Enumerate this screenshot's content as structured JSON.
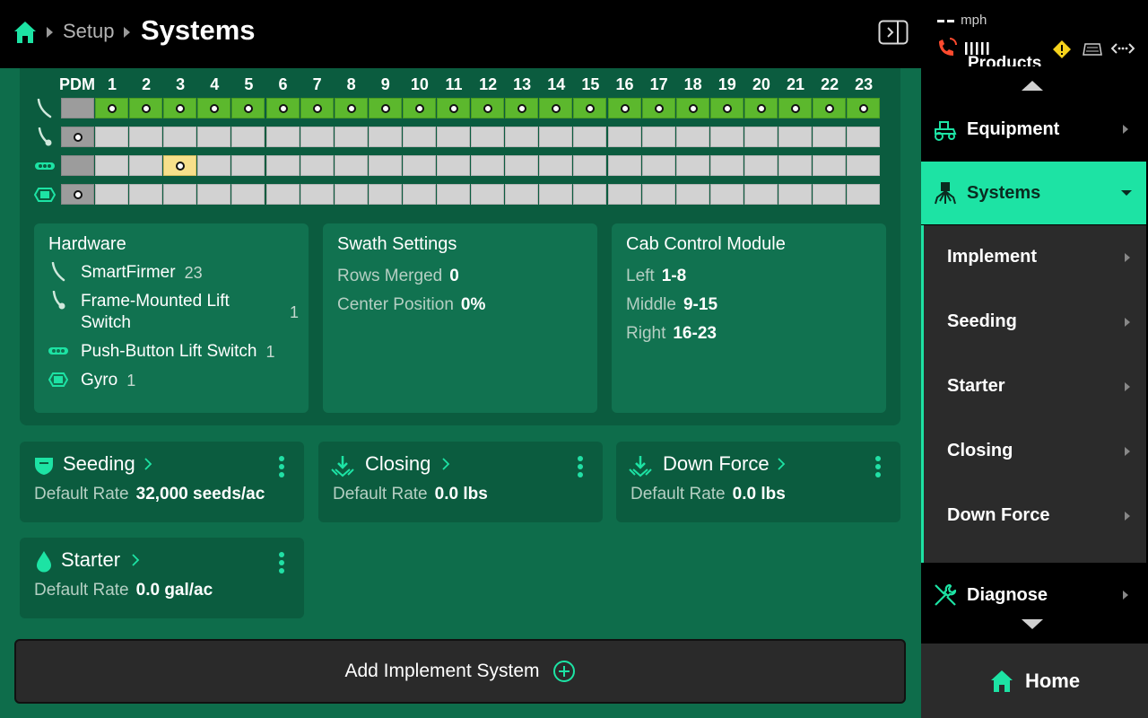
{
  "header": {
    "breadcrumb_setup": "Setup",
    "title": "Systems"
  },
  "status": {
    "speed_unit": "mph"
  },
  "grid": {
    "pdm_label": "PDM",
    "columns": [
      "1",
      "2",
      "3",
      "4",
      "5",
      "6",
      "7",
      "8",
      "9",
      "10",
      "11",
      "12",
      "13",
      "14",
      "15",
      "16",
      "17",
      "18",
      "19",
      "20",
      "21",
      "22",
      "23"
    ],
    "rows": [
      {
        "name": "smartfirmer",
        "pdm": "empty",
        "cells": "all-green-dot"
      },
      {
        "name": "frame-mounted-lift-switch",
        "pdm": "dot",
        "cells": "empty"
      },
      {
        "name": "push-button-lift-switch",
        "pdm": "empty",
        "cells": "yellow-at-3"
      },
      {
        "name": "gyro",
        "pdm": "dot",
        "cells": "empty"
      }
    ],
    "yellow_row_active_column": 3
  },
  "hardware": {
    "title": "Hardware",
    "items": [
      {
        "name": "SmartFirmer",
        "count": "23"
      },
      {
        "name": "Frame-Mounted Lift Switch",
        "count": "1"
      },
      {
        "name": "Push-Button Lift Switch",
        "count": "1"
      },
      {
        "name": "Gyro",
        "count": "1"
      }
    ]
  },
  "swath": {
    "title": "Swath Settings",
    "rows_merged_label": "Rows Merged",
    "rows_merged_value": "0",
    "center_position_label": "Center Position",
    "center_position_value": "0%"
  },
  "cab": {
    "title": "Cab Control Module",
    "left_label": "Left",
    "left_value": "1-8",
    "middle_label": "Middle",
    "middle_value": "9-15",
    "right_label": "Right",
    "right_value": "16-23"
  },
  "systems": [
    {
      "title": "Seeding",
      "rate_label": "Default Rate",
      "rate_value": "32,000 seeds/ac",
      "icon": "seed-icon"
    },
    {
      "title": "Closing",
      "rate_label": "Default Rate",
      "rate_value": "0.0 lbs",
      "icon": "closing-icon"
    },
    {
      "title": "Down Force",
      "rate_label": "Default Rate",
      "rate_value": "0.0 lbs",
      "icon": "down-force-icon"
    },
    {
      "title": "Starter",
      "rate_label": "Default Rate",
      "rate_value": "0.0 gal/ac",
      "icon": "droplet-icon"
    }
  ],
  "add_button_label": "Add Implement System",
  "sidebar": {
    "clipped_label": "Products",
    "equipment": "Equipment",
    "systems": "Systems",
    "sub_items": [
      "Implement",
      "Seeding",
      "Starter",
      "Closing",
      "Down Force"
    ],
    "diagnose": "Diagnose",
    "home": "Home"
  },
  "colors": {
    "accent": "#1de3a4",
    "main_bg": "#0e6d4b",
    "panel_bg": "#0b5c3f",
    "active_cell": "#5cb82d",
    "warning": "#f5d21c",
    "alert": "#ff4a2e"
  }
}
